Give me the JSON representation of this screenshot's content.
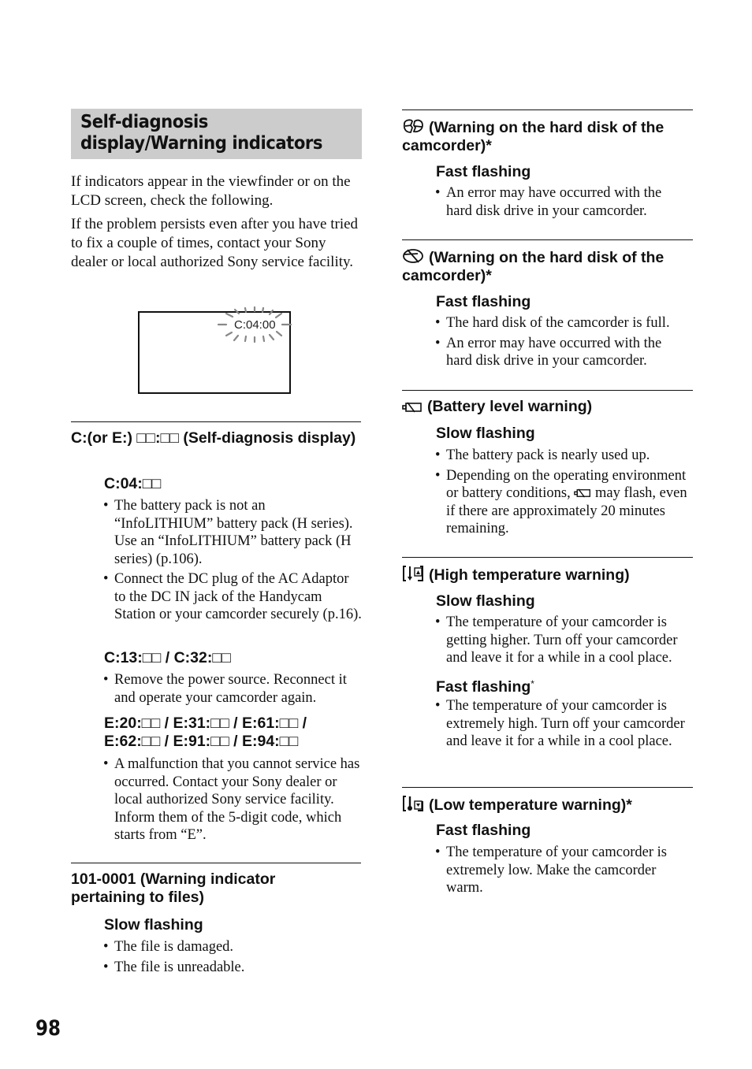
{
  "page_title": "Self-diagnosis display/Warning indicators",
  "intro": [
    "If indicators appear in the viewfinder or on the LCD screen, check the following.",
    "If the problem persists even after you have tried to fix a couple of times, contact your Sony dealer or local authorized Sony service facility."
  ],
  "illustration": {
    "code_label": "C:04:00",
    "icon": "flashing-indicator"
  },
  "left": {
    "self_diag": {
      "heading": "C:(or E:) □□:□□ (Self-diagnosis display)",
      "groups": [
        {
          "code": "C:04:□□",
          "bullets": [
            "The battery pack is not an “InfoLITHIUM” battery pack (H series). Use an “InfoLITHIUM” battery pack (H series) (p.106).",
            "Connect the DC plug of the AC Adaptor to the DC IN jack of the Handycam Station or your camcorder securely (p.16)."
          ]
        },
        {
          "code": "C:13:□□ / C:32:□□",
          "bullets": [
            "Remove the power source. Reconnect it and operate your camcorder again."
          ]
        },
        {
          "code": "E:20:□□ / E:31:□□ / E:61:□□ / E:62:□□ / E:91:□□ / E:94:□□",
          "bullets": [
            "A malfunction that you cannot service has occurred. Contact your Sony dealer or local authorized Sony service facility. Inform them of the 5-digit code, which starts from “E”."
          ]
        }
      ]
    },
    "file_warning": {
      "heading": "101-0001 (Warning indicator pertaining to files)",
      "sub": "Slow flashing",
      "bullets": [
        "The file is damaged.",
        "The file is unreadable."
      ]
    }
  },
  "right": {
    "hdd_error": {
      "icon": "hard-disk-error-icon",
      "heading": "(Warning on the hard disk of the camcorder)*",
      "sub": "Fast flashing",
      "bullets": [
        "An error may have occurred with the hard disk drive in your camcorder."
      ]
    },
    "hdd_full": {
      "icon": "hard-disk-full-icon",
      "heading": "(Warning on the hard disk of the camcorder)*",
      "sub": "Fast flashing",
      "bullets": [
        "The hard disk of the camcorder is full.",
        "An error may have occurred with the hard disk drive in your camcorder."
      ]
    },
    "battery": {
      "icon": "battery-empty-icon",
      "heading": "(Battery level warning)",
      "sub": "Slow flashing",
      "bullets": [
        "The battery pack is nearly used up.",
        "Depending on the operating environment or battery conditions,",
        "may flash, even if there are approximately 20 minutes remaining."
      ]
    },
    "high_temp": {
      "icon": "high-temperature-icon",
      "heading": "(High temperature warning)",
      "sub1": "Slow flashing",
      "bullets1": [
        "The temperature of your camcorder is getting higher. Turn off your camcorder and leave it for a while in a cool place."
      ],
      "sub2": "Fast flashing",
      "sub2_mark": "*",
      "bullets2": [
        "The temperature of your camcorder is extremely high. Turn off your camcorder and leave it for a while in a cool place."
      ]
    },
    "low_temp": {
      "icon": "low-temperature-icon",
      "heading": "(Low temperature warning)*",
      "sub": "Fast flashing",
      "bullets": [
        "The temperature of your camcorder is extremely low. Make the camcorder warm."
      ]
    }
  },
  "page_number": "98"
}
